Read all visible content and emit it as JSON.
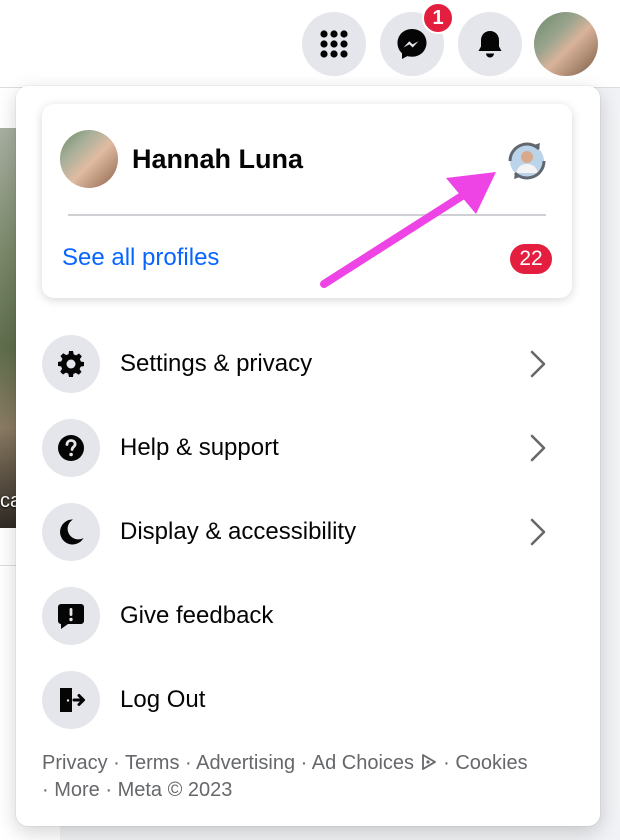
{
  "topbar": {
    "icons": [
      "apps-grid-icon",
      "messenger-icon",
      "bell-icon"
    ],
    "messenger_badge": "1"
  },
  "background": {
    "photo_label": "ca"
  },
  "profile": {
    "name": "Hannah Luna",
    "see_all_label": "See all profiles",
    "profile_count": "22"
  },
  "menu": {
    "items": [
      {
        "label": "Settings & privacy",
        "icon": "gear-icon",
        "has_chevron": true
      },
      {
        "label": "Help & support",
        "icon": "question-icon",
        "has_chevron": true
      },
      {
        "label": "Display & accessibility",
        "icon": "moon-icon",
        "has_chevron": true
      },
      {
        "label": "Give feedback",
        "icon": "feedback-icon",
        "has_chevron": false
      },
      {
        "label": "Log Out",
        "icon": "logout-icon",
        "has_chevron": false
      }
    ]
  },
  "footer": {
    "links": [
      "Privacy",
      "Terms",
      "Advertising",
      "Ad Choices",
      "Cookies",
      "More"
    ],
    "separator": " · ",
    "copyright": "Meta © 2023"
  },
  "colors": {
    "link_blue": "#0866ff",
    "badge_red": "#e41e3f",
    "annotation_arrow": "#ee44e6"
  }
}
